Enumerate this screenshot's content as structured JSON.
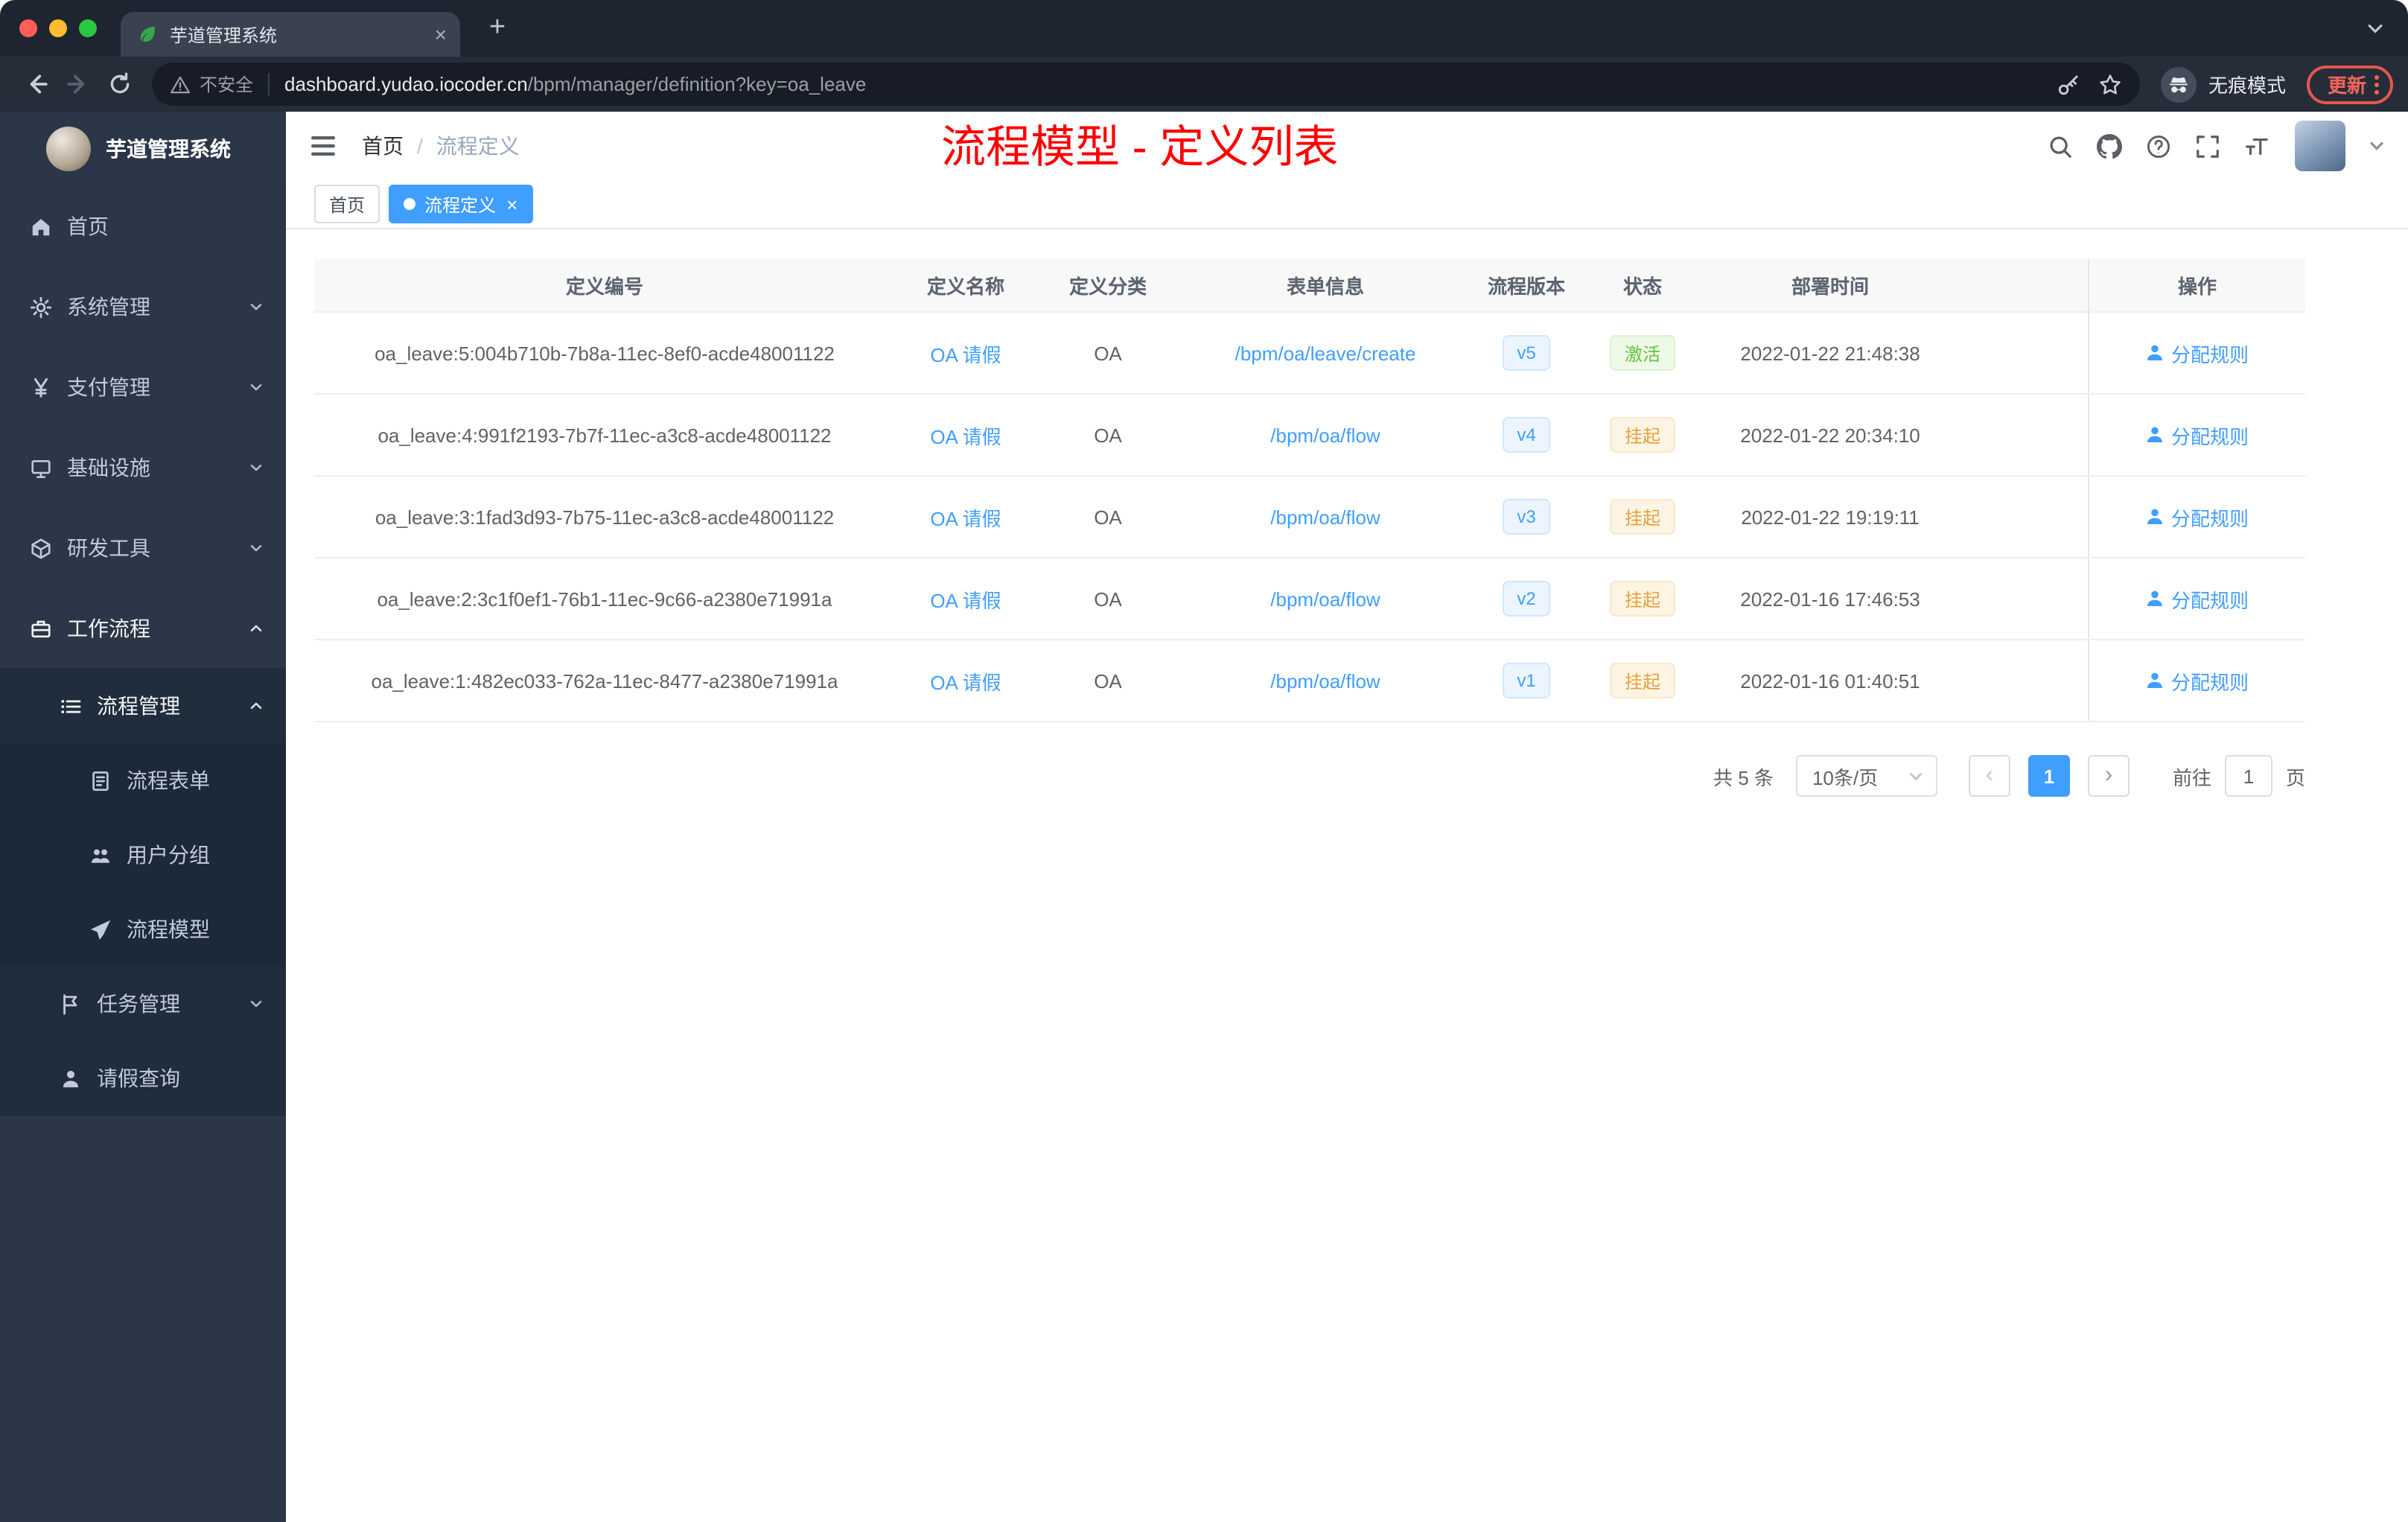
{
  "colors": {
    "accent": "#409eff",
    "success": "#67c23a",
    "warning": "#e6a23c",
    "annotation_red": "#fe0000",
    "sidebar_bg": "#2b3648",
    "sidebar_sub_bg": "#1f2d3d"
  },
  "browser": {
    "tab_title": "芋道管理系统",
    "security_label": "不安全",
    "url_domain": "dashboard.yudao.iocoder.cn",
    "url_path": "/bpm/manager/definition?key=oa_leave",
    "incognito_label": "无痕模式",
    "update_label": "更新"
  },
  "sidebar": {
    "logo_title": "芋道管理系统",
    "items": [
      {
        "id": "home",
        "label": "首页",
        "icon": "home-icon",
        "level": 0
      },
      {
        "id": "system-management",
        "label": "系统管理",
        "icon": "gear-icon",
        "level": 0,
        "chevron": "down"
      },
      {
        "id": "payment-management",
        "label": "支付管理",
        "icon": "yen-icon",
        "level": 0,
        "chevron": "down"
      },
      {
        "id": "infrastructure",
        "label": "基础设施",
        "icon": "infra-icon",
        "level": 0,
        "chevron": "down"
      },
      {
        "id": "dev-tools",
        "label": "研发工具",
        "icon": "tools-icon",
        "level": 0,
        "chevron": "down"
      },
      {
        "id": "workflow",
        "label": "工作流程",
        "icon": "workflow-icon",
        "level": 0,
        "chevron": "up",
        "active": true
      },
      {
        "id": "process-management",
        "label": "流程管理",
        "icon": "list-icon",
        "level": 1,
        "sub": true,
        "chevron": "up",
        "active": true
      },
      {
        "id": "process-form",
        "label": "流程表单",
        "icon": "form-icon",
        "level": 2,
        "sub": true
      },
      {
        "id": "user-group",
        "label": "用户分组",
        "icon": "group-icon",
        "level": 2,
        "sub": true
      },
      {
        "id": "process-model",
        "label": "流程模型",
        "icon": "plane-icon",
        "level": 2,
        "sub": true
      },
      {
        "id": "task-management",
        "label": "任务管理",
        "icon": "task-icon",
        "level": 1,
        "sub": true,
        "chevron": "down"
      },
      {
        "id": "leave-query",
        "label": "请假查询",
        "icon": "user-icon",
        "level": 1,
        "sub": true
      }
    ]
  },
  "header": {
    "breadcrumb": [
      {
        "label": "首页"
      },
      {
        "label": "流程定义"
      }
    ],
    "annotation": "流程模型 - 定义列表",
    "icons": [
      "search-icon",
      "github-icon",
      "help-icon",
      "fullscreen-icon",
      "font-size-icon"
    ]
  },
  "tags": [
    {
      "id": "home",
      "label": "首页",
      "active": false,
      "closable": false
    },
    {
      "id": "process-definition",
      "label": "流程定义",
      "active": true,
      "closable": true
    }
  ],
  "table": {
    "columns": [
      {
        "key": "id",
        "label": "定义编号"
      },
      {
        "key": "name",
        "label": "定义名称"
      },
      {
        "key": "category",
        "label": "定义分类"
      },
      {
        "key": "form",
        "label": "表单信息"
      },
      {
        "key": "version",
        "label": "流程版本"
      },
      {
        "key": "status",
        "label": "状态"
      },
      {
        "key": "time",
        "label": "部署时间"
      },
      {
        "key": "action",
        "label": "操作"
      }
    ],
    "rows": [
      {
        "id": "oa_leave:5:004b710b-7b8a-11ec-8ef0-acde48001122",
        "name": "OA 请假",
        "category": "OA",
        "form": "/bpm/oa/leave/create",
        "version": "v5",
        "status": "激活",
        "status_type": "success",
        "time": "2022-01-22 21:48:38",
        "action": "分配规则"
      },
      {
        "id": "oa_leave:4:991f2193-7b7f-11ec-a3c8-acde48001122",
        "name": "OA 请假",
        "category": "OA",
        "form": "/bpm/oa/flow",
        "version": "v4",
        "status": "挂起",
        "status_type": "warning",
        "time": "2022-01-22 20:34:10",
        "action": "分配规则"
      },
      {
        "id": "oa_leave:3:1fad3d93-7b75-11ec-a3c8-acde48001122",
        "name": "OA 请假",
        "category": "OA",
        "form": "/bpm/oa/flow",
        "version": "v3",
        "status": "挂起",
        "status_type": "warning",
        "time": "2022-01-22 19:19:11",
        "action": "分配规则"
      },
      {
        "id": "oa_leave:2:3c1f0ef1-76b1-11ec-9c66-a2380e71991a",
        "name": "OA 请假",
        "category": "OA",
        "form": "/bpm/oa/flow",
        "version": "v2",
        "status": "挂起",
        "status_type": "warning",
        "time": "2022-01-16 17:46:53",
        "action": "分配规则"
      },
      {
        "id": "oa_leave:1:482ec033-762a-11ec-8477-a2380e71991a",
        "name": "OA 请假",
        "category": "OA",
        "form": "/bpm/oa/flow",
        "version": "v1",
        "status": "挂起",
        "status_type": "warning",
        "time": "2022-01-16 01:40:51",
        "action": "分配规则"
      }
    ]
  },
  "pagination": {
    "total": "共 5 条",
    "page_size": "10条/页",
    "current_page": "1",
    "goto_label": "前往",
    "goto_value": "1",
    "page_unit": "页"
  }
}
